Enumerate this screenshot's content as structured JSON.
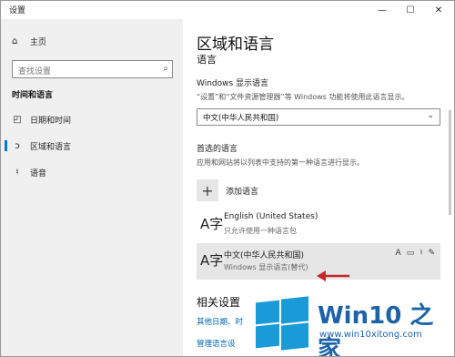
{
  "window": {
    "title": "设置",
    "min_glyph": "—",
    "max_glyph": "☐",
    "close_glyph": "✕"
  },
  "sidebar": {
    "home_label": "主页",
    "search_placeholder": "查找设置",
    "section_title": "时间和语言",
    "items": [
      {
        "label": "日期和时间",
        "icon": "calendar-clock-icon"
      },
      {
        "label": "区域和语言",
        "icon": "globe-pen-icon",
        "active": true
      },
      {
        "label": "语音",
        "icon": "microphone-icon"
      }
    ]
  },
  "content": {
    "title": "区域和语言",
    "subtitle": "语言",
    "display_lang_label": "Windows 显示语言",
    "display_lang_desc": "“设置”和“文件资源管理器”等 Windows 功能将使用此语言显示。",
    "display_lang_value": "中文(中华人民共和国)",
    "preferred_label": "首选的语言",
    "preferred_desc": "应用和网站将以列表中支持的第一种语言进行显示。",
    "add_lang_label": "添加语言",
    "languages": [
      {
        "name": "English (United States)",
        "sub": "只允许使用一种语言包",
        "selected": false
      },
      {
        "name": "中文(中华人民共和国)",
        "sub": "Windows 显示语言(替代)",
        "selected": true
      }
    ],
    "related_title": "相关设置",
    "related_links": [
      "其他日期、时",
      "管理语言设"
    ]
  },
  "watermark": {
    "brand": "Win10 之家",
    "url": "www.win10xitong.com"
  },
  "colors": {
    "accent": "#0078d7",
    "link": "#0063b1",
    "logo": "#1a9ad6",
    "arrow": "#c0282d"
  }
}
